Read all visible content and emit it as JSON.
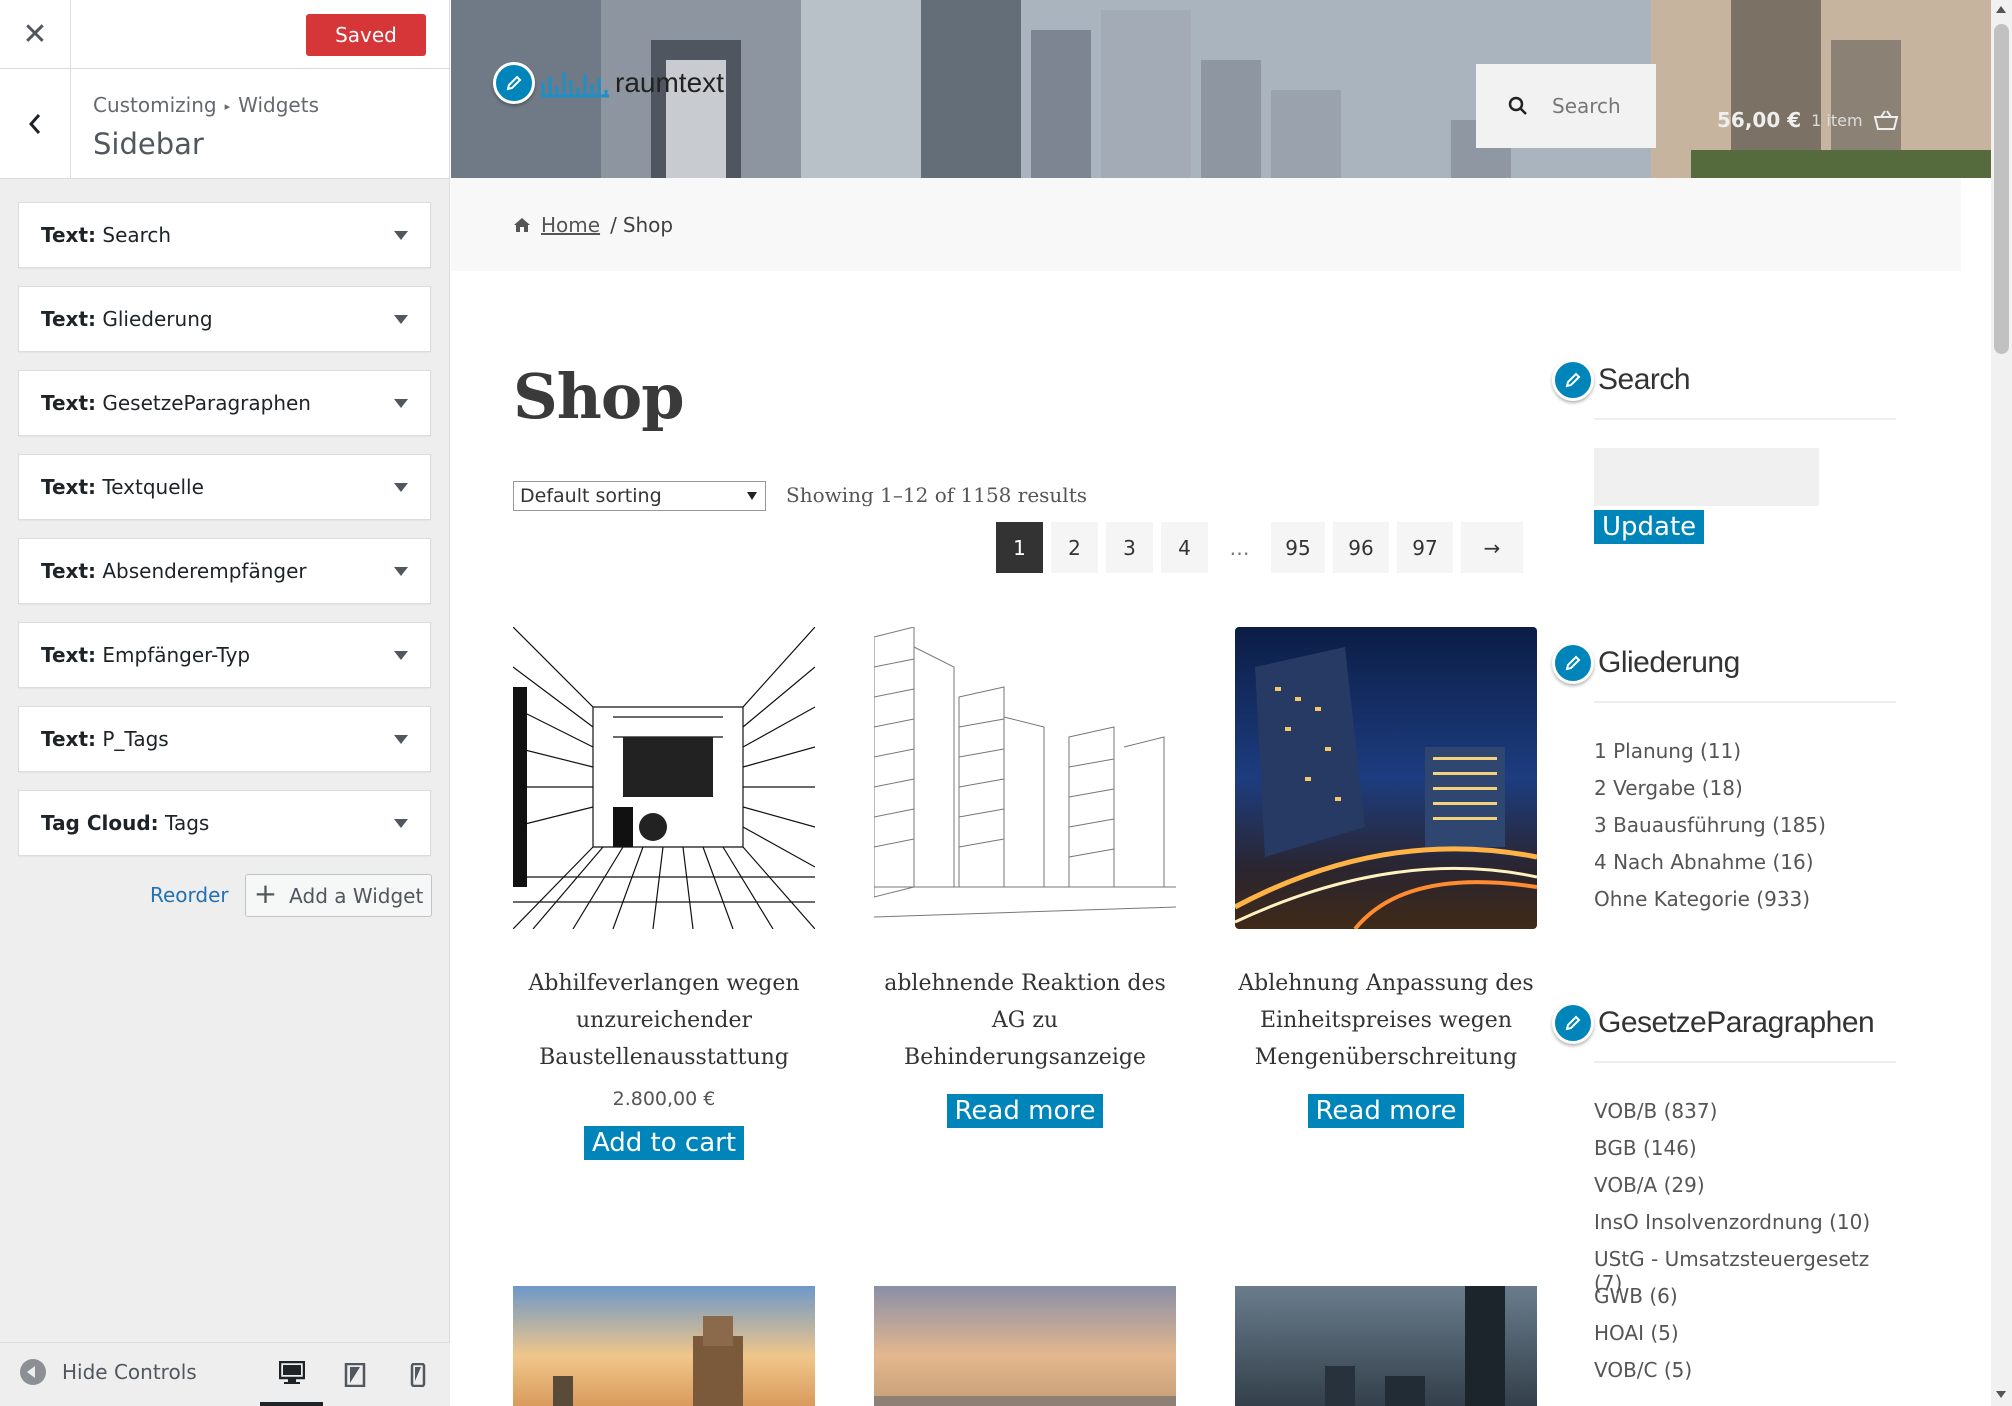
{
  "customizer": {
    "saved_label": "Saved",
    "breadcrumb": [
      "Customizing",
      "Widgets"
    ],
    "section_title": "Sidebar",
    "widgets": [
      {
        "type": "Text:",
        "name": "Search"
      },
      {
        "type": "Text:",
        "name": "Gliederung"
      },
      {
        "type": "Text:",
        "name": "GesetzeParagraphen"
      },
      {
        "type": "Text:",
        "name": "Textquelle"
      },
      {
        "type": "Text:",
        "name": "Absenderempfänger"
      },
      {
        "type": "Text:",
        "name": "Empfänger-Typ"
      },
      {
        "type": "Text:",
        "name": "P_Tags"
      },
      {
        "type": "Tag Cloud:",
        "name": "Tags"
      }
    ],
    "reorder_label": "Reorder",
    "add_widget_label": "Add a Widget",
    "hide_controls_label": "Hide Controls",
    "colors": {
      "saved": "#d63638",
      "link": "#2271b1"
    }
  },
  "site": {
    "logo_text": "raumtext",
    "search_placeholder": "Search",
    "cart_total": "56,00 €",
    "cart_items": "1 item",
    "breadcrumb": {
      "home": "Home",
      "separator": "/",
      "current": "Shop"
    },
    "page_title": "Shop",
    "sorting": "Default sorting",
    "result_count": "Showing 1–12 of 1158 results",
    "pagination": [
      "1",
      "2",
      "3",
      "4",
      "…",
      "95",
      "96",
      "97",
      "→"
    ],
    "current_page": "1",
    "accent_color": "#0085ba",
    "products": [
      {
        "title": "Abhilfeverlangen wegen unzureichender Baustellenausstattung",
        "price": "2.800,00 €",
        "button": "Add to cart"
      },
      {
        "title": "ablehnende Reaktion des AG zu Behinderungsanzeige",
        "price": "",
        "button": "Read more"
      },
      {
        "title": "Ablehnung Anpassung des Einheitspreises wegen Mengenüberschreitung",
        "price": "",
        "button": "Read more"
      }
    ],
    "sidebar": {
      "search": {
        "title": "Search",
        "button": "Update"
      },
      "gliederung": {
        "title": "Gliederung",
        "items": [
          "1 Planung (11)",
          "2 Vergabe (18)",
          "3 Bauausführung (185)",
          "4 Nach Abnahme (16)",
          "Ohne Kategorie (933)"
        ]
      },
      "gesetze": {
        "title": "GesetzeParagraphen",
        "items": [
          "VOB/B (837)",
          "BGB (146)",
          "VOB/A (29)",
          "InsO Insolvenzordnung (10)",
          "UStG - Umsatzsteuergesetz (7)",
          "GWB (6)",
          "HOAI (5)",
          "VOB/C (5)"
        ]
      }
    }
  }
}
